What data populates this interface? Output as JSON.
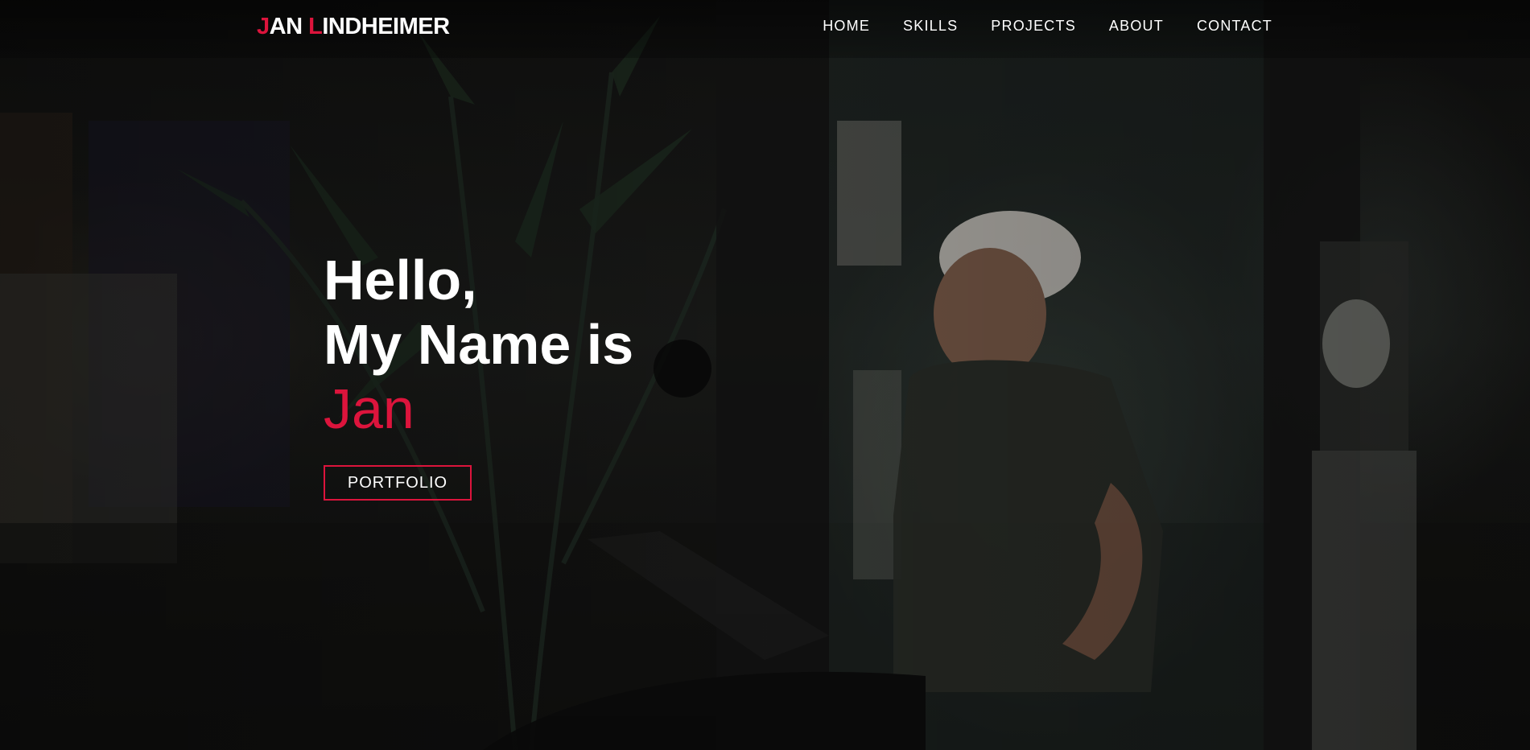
{
  "brand": {
    "first_initial": "J",
    "first_rest": "AN ",
    "last_initial": "L",
    "last_rest": "INDHEIMER",
    "accent_color": "#dc143c"
  },
  "nav": {
    "items": [
      {
        "label": "HOME"
      },
      {
        "label": "SKILLS"
      },
      {
        "label": "PROJECTS"
      },
      {
        "label": "ABOUT"
      },
      {
        "label": "CONTACT"
      }
    ]
  },
  "hero": {
    "line1": "Hello,",
    "line2": "My Name is",
    "name": "Jan",
    "button_label": "PORTFOLIO",
    "background_image": "person-with-cap-sitting-with-laptop-photo"
  },
  "colors": {
    "accent": "#dc143c",
    "text": "#ffffff",
    "background": "#0c0c0c"
  }
}
